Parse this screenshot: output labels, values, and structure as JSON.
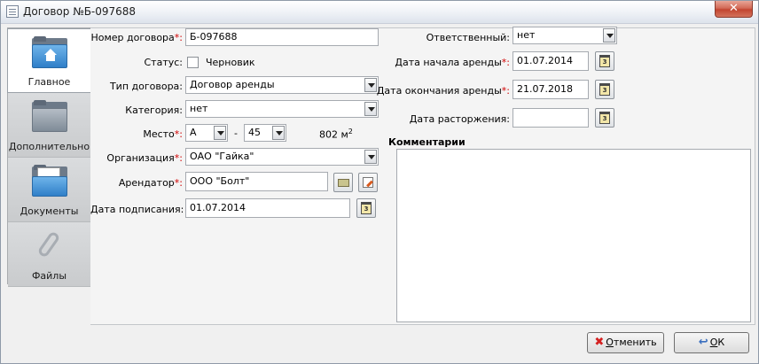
{
  "window": {
    "title": "Договор №Б-097688",
    "close_glyph": "✕"
  },
  "tabs": [
    {
      "label": "Главное",
      "icon": "home-folder-icon",
      "active": true
    },
    {
      "label": "Дополнительно",
      "icon": "folder-icon",
      "active": false
    },
    {
      "label": "Документы",
      "icon": "documents-folder-icon",
      "active": false
    },
    {
      "label": "Файлы",
      "icon": "paperclip-icon",
      "active": false
    }
  ],
  "form": {
    "contract_number": {
      "label": "Номер договора",
      "required_mark": "*:",
      "value": "Б-097688"
    },
    "status": {
      "label": "Статус:",
      "checkbox_label": "Черновик",
      "checked": false
    },
    "contract_type": {
      "label": "Тип договора:",
      "value": "Договор аренды"
    },
    "category": {
      "label": "Категория:",
      "value": "нет"
    },
    "place": {
      "label": "Место",
      "required_mark": "*:",
      "value1": "А",
      "separator": "-",
      "value2": "45",
      "area": "802 м",
      "area_sup": "2"
    },
    "organization": {
      "label": "Организация",
      "required_mark": "*:",
      "value": "ОАО \"Гайка\""
    },
    "tenant": {
      "label": "Арендатор",
      "required_mark": "*:",
      "value": "ООО \"Болт\""
    },
    "signing_date": {
      "label": "Дата подписания:",
      "value": "01.07.2014"
    },
    "responsible": {
      "label": "Ответственный:",
      "value": "нет"
    },
    "lease_start": {
      "label": "Дата начала аренды",
      "required_mark": "*:",
      "value": "01.07.2014"
    },
    "lease_end": {
      "label": "Дата окончания аренды",
      "required_mark": "*:",
      "value": "21.07.2018"
    },
    "termination_date": {
      "label": "Дата расторжения:",
      "value": ""
    },
    "comments": {
      "label": "Комментарии",
      "value": ""
    }
  },
  "calendar_glyph": "3",
  "buttons": {
    "cancel": {
      "icon_glyph": "✖",
      "pre": "О",
      "rest": "тменить"
    },
    "ok": {
      "icon_glyph": "↩",
      "pre": "О",
      "rest": "К"
    }
  },
  "colors": {
    "required": "#d10000",
    "accent": "#2f7fc8"
  }
}
